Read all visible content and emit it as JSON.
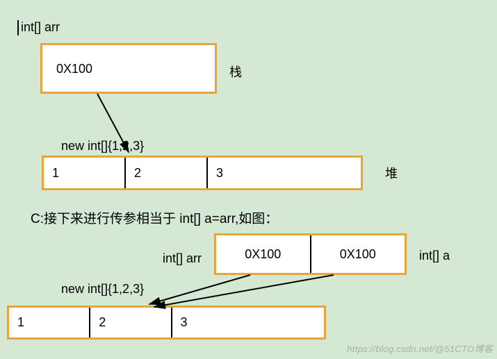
{
  "top": {
    "decl_label": "int[] arr",
    "stack_value": "0X100",
    "stack_label": "栈",
    "heap_init_label": "new int[]{1,2,3}",
    "heap_cells": [
      "1",
      "2",
      "3"
    ],
    "heap_label": "堆"
  },
  "caption": "C:接下来进行传参相当于 int[]  a=arr,如图：",
  "bottom": {
    "left_label": "int[] arr",
    "stack_cells": [
      "0X100",
      "0X100"
    ],
    "right_label": "int[] a",
    "heap_init_label": "new int[]{1,2,3}",
    "heap_cells": [
      "1",
      "2",
      "3"
    ]
  },
  "watermark": "https://blog.csdn.net/@51CTO博客"
}
